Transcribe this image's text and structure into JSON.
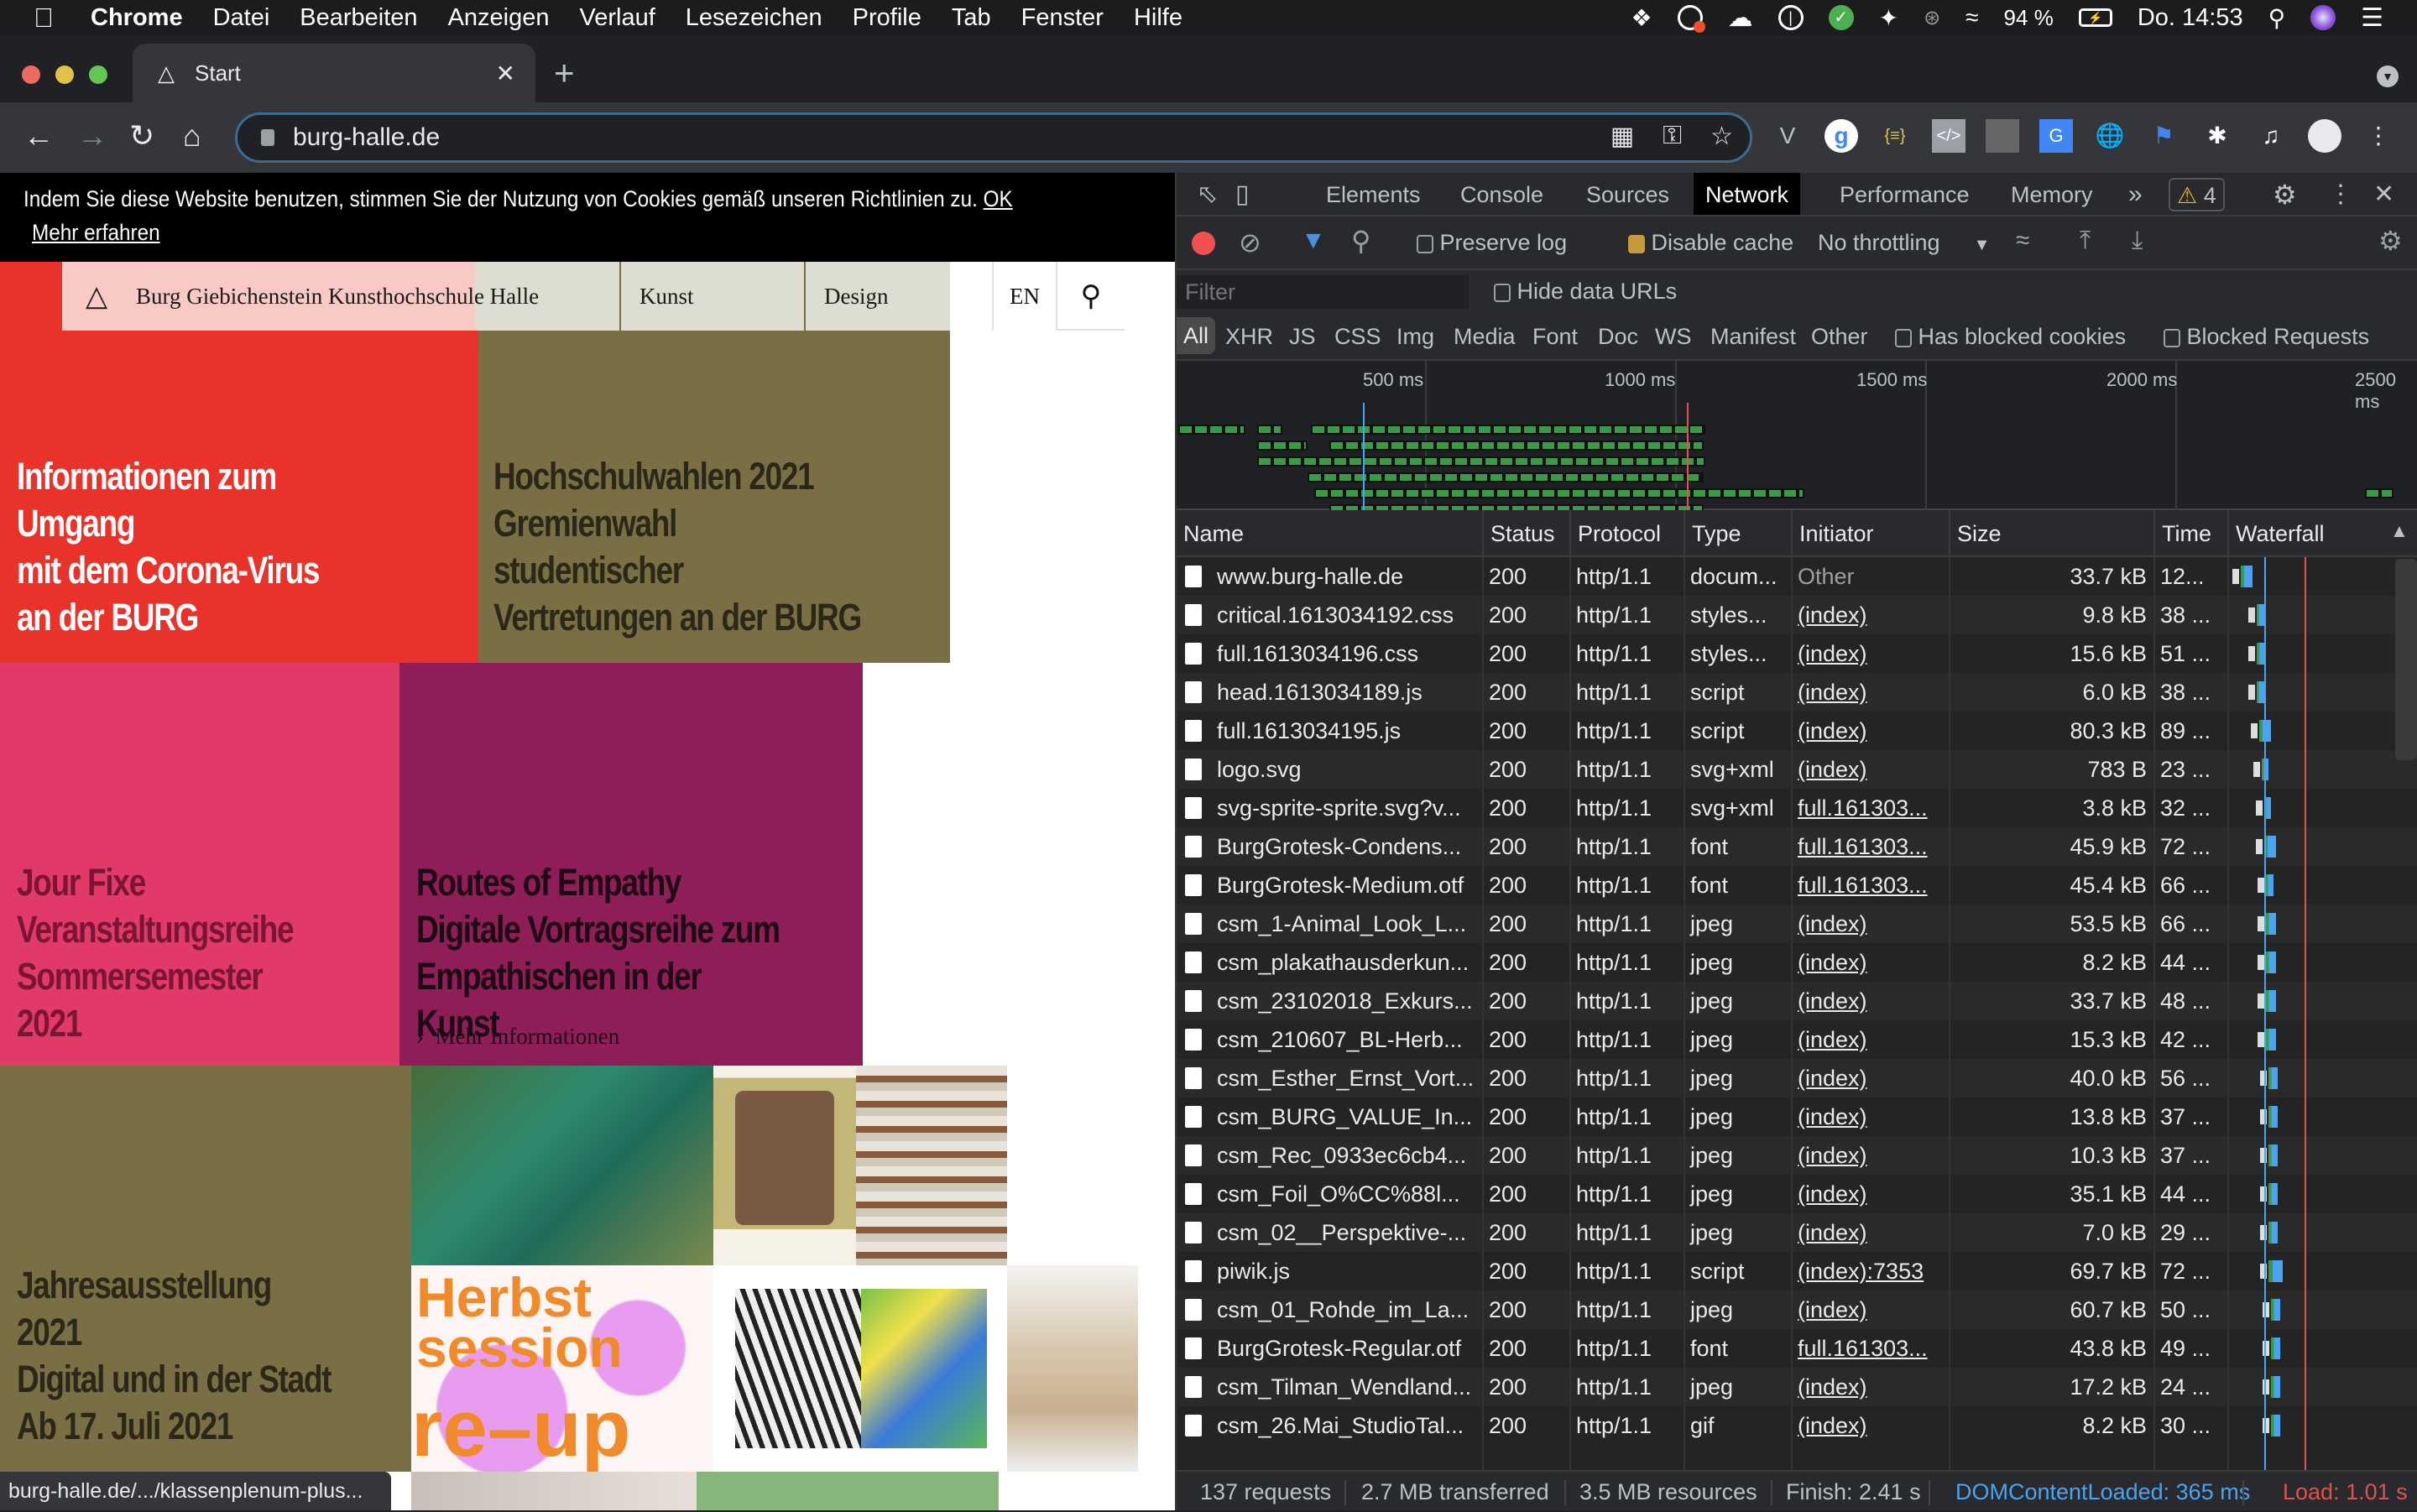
{
  "menubar": {
    "app": "Chrome",
    "items": [
      "Datei",
      "Bearbeiten",
      "Anzeigen",
      "Verlauf",
      "Lesezeichen",
      "Profile",
      "Tab",
      "Fenster",
      "Hilfe"
    ],
    "battery": "94 %",
    "clock": "Do. 14:53",
    "status_icons": [
      "dropbox-icon",
      "creative-cloud-icon",
      "cloud-pause-icon",
      "1password-icon",
      "checkmark-icon",
      "fluid-icon",
      "bluetooth-icon",
      "wifi-icon",
      "battery-icon",
      "spotlight-icon",
      "siri-icon",
      "control-center-icon"
    ]
  },
  "browser": {
    "tab_title": "Start",
    "url": "burg-halle.de",
    "status_url": "burg-halle.de/.../klassenplenum-plus..."
  },
  "website": {
    "cookie_text": "Indem Sie diese Website benutzen, stimmen Sie der Nutzung von Cookies gemäß unseren Richtlinien zu.",
    "cookie_ok": "OK",
    "cookie_more": "Mehr erfahren",
    "brand": "Burg Giebichenstein Kunsthochschule Halle",
    "nav": [
      "Kunst",
      "Design"
    ],
    "lang": "EN",
    "tiles": [
      {
        "lines": [
          "Informationen zum Umgang",
          "mit dem Corona-Virus",
          "an der BURG"
        ],
        "bg": "#e8322a",
        "fg": "#ffffff"
      },
      {
        "lines": [
          "Hochschulwahlen 2021",
          "Gremienwahl studentischer",
          "Vertretungen an der BURG"
        ],
        "bg": "#7a6e45",
        "fg": "#2b2818"
      },
      {
        "lines": [
          "Jour Fixe",
          "Veranstaltungsreihe",
          "Sommersemester 2021"
        ],
        "bg": "#e23a68",
        "fg": "#7a1535"
      },
      {
        "lines": [
          "Routes of Empathy",
          "Digitale Vortragsreihe zum",
          "Empathischen in der Kunst"
        ],
        "bg": "#8f1d58",
        "fg": "#1e0a14",
        "more": "Mehr Informationen"
      },
      {
        "lines": [
          "Jahresausstellung 2021",
          "Digital und in der Stadt",
          "Ab 17. Juli 2021"
        ],
        "bg": "#7a6e45",
        "fg": "#2b2818"
      }
    ]
  },
  "devtools": {
    "tabs": [
      "Elements",
      "Console",
      "Sources",
      "Network",
      "Performance",
      "Memory"
    ],
    "active_tab": "Network",
    "warnings": "4",
    "toolbar": {
      "preserve_log": "Preserve log",
      "preserve_log_checked": false,
      "disable_cache": "Disable cache",
      "disable_cache_checked": true,
      "throttling": "No throttling"
    },
    "filter_placeholder": "Filter",
    "hide_data_urls": "Hide data URLs",
    "type_filters": [
      "All",
      "XHR",
      "JS",
      "CSS",
      "Img",
      "Media",
      "Font",
      "Doc",
      "WS",
      "Manifest",
      "Other"
    ],
    "has_blocked_cookies": "Has blocked cookies",
    "blocked_requests": "Blocked Requests",
    "overview_ticks": [
      "500 ms",
      "1000 ms",
      "1500 ms",
      "2000 ms",
      "2500 ms"
    ],
    "columns": [
      "Name",
      "Status",
      "Protocol",
      "Type",
      "Initiator",
      "Size",
      "Time",
      "Waterfall"
    ],
    "requests": [
      {
        "name": "www.burg-halle.de",
        "status": "200",
        "protocol": "http/1.1",
        "type": "docum...",
        "initiator": "Other",
        "size": "33.7 kB",
        "time": "12...",
        "start": 0.02,
        "dur": 0.05
      },
      {
        "name": "critical.1613034192.css",
        "status": "200",
        "protocol": "http/1.1",
        "type": "styles...",
        "initiator": "(index)",
        "size": "9.8 kB",
        "time": "38 ...",
        "start": 0.09,
        "dur": 0.03
      },
      {
        "name": "full.1613034196.css",
        "status": "200",
        "protocol": "http/1.1",
        "type": "styles...",
        "initiator": "(index)",
        "size": "15.6 kB",
        "time": "51 ...",
        "start": 0.09,
        "dur": 0.04
      },
      {
        "name": "head.1613034189.js",
        "status": "200",
        "protocol": "http/1.1",
        "type": "script",
        "initiator": "(index)",
        "size": "6.0 kB",
        "time": "38 ...",
        "start": 0.09,
        "dur": 0.03
      },
      {
        "name": "full.1613034195.js",
        "status": "200",
        "protocol": "http/1.1",
        "type": "script",
        "initiator": "(index)",
        "size": "80.3 kB",
        "time": "89 ...",
        "start": 0.1,
        "dur": 0.05
      },
      {
        "name": "logo.svg",
        "status": "200",
        "protocol": "http/1.1",
        "type": "svg+xml",
        "initiator": "(index)",
        "size": "783 B",
        "time": "23 ...",
        "start": 0.11,
        "dur": 0.03
      },
      {
        "name": "svg-sprite-sprite.svg?v...",
        "status": "200",
        "protocol": "http/1.1",
        "type": "svg+xml",
        "initiator": "full.161303...",
        "size": "3.8 kB",
        "time": "32 ...",
        "start": 0.12,
        "dur": 0.03
      },
      {
        "name": "BurgGrotesk-Condens...",
        "status": "200",
        "protocol": "http/1.1",
        "type": "font",
        "initiator": "full.161303...",
        "size": "45.9 kB",
        "time": "72 ...",
        "start": 0.12,
        "dur": 0.05
      },
      {
        "name": "BurgGrotesk-Medium.otf",
        "status": "200",
        "protocol": "http/1.1",
        "type": "font",
        "initiator": "full.161303...",
        "size": "45.4 kB",
        "time": "66 ...",
        "start": 0.13,
        "dur": 0.03
      },
      {
        "name": "csm_1-Animal_Look_L...",
        "status": "200",
        "protocol": "http/1.1",
        "type": "jpeg",
        "initiator": "(index)",
        "size": "53.5 kB",
        "time": "66 ...",
        "start": 0.13,
        "dur": 0.04
      },
      {
        "name": "csm_plakathausderkun...",
        "status": "200",
        "protocol": "http/1.1",
        "type": "jpeg",
        "initiator": "(index)",
        "size": "8.2 kB",
        "time": "44 ...",
        "start": 0.13,
        "dur": 0.04
      },
      {
        "name": "csm_23102018_Exkurs...",
        "status": "200",
        "protocol": "http/1.1",
        "type": "jpeg",
        "initiator": "(index)",
        "size": "33.7 kB",
        "time": "48 ...",
        "start": 0.13,
        "dur": 0.04
      },
      {
        "name": "csm_210607_BL-Herb...",
        "status": "200",
        "protocol": "http/1.1",
        "type": "jpeg",
        "initiator": "(index)",
        "size": "15.3 kB",
        "time": "42 ...",
        "start": 0.13,
        "dur": 0.04
      },
      {
        "name": "csm_Esther_Ernst_Vort...",
        "status": "200",
        "protocol": "http/1.1",
        "type": "jpeg",
        "initiator": "(index)",
        "size": "40.0 kB",
        "time": "56 ...",
        "start": 0.14,
        "dur": 0.04
      },
      {
        "name": "csm_BURG_VALUE_In...",
        "status": "200",
        "protocol": "http/1.1",
        "type": "jpeg",
        "initiator": "(index)",
        "size": "13.8 kB",
        "time": "37 ...",
        "start": 0.14,
        "dur": 0.04
      },
      {
        "name": "csm_Rec_0933ec6cb4...",
        "status": "200",
        "protocol": "http/1.1",
        "type": "jpeg",
        "initiator": "(index)",
        "size": "10.3 kB",
        "time": "37 ...",
        "start": 0.14,
        "dur": 0.04
      },
      {
        "name": "csm_Foil_O%CC%88l...",
        "status": "200",
        "protocol": "http/1.1",
        "type": "jpeg",
        "initiator": "(index)",
        "size": "35.1 kB",
        "time": "44 ...",
        "start": 0.14,
        "dur": 0.04
      },
      {
        "name": "csm_02__Perspektive-...",
        "status": "200",
        "protocol": "http/1.1",
        "type": "jpeg",
        "initiator": "(index)",
        "size": "7.0 kB",
        "time": "29 ...",
        "start": 0.14,
        "dur": 0.04
      },
      {
        "name": "piwik.js",
        "status": "200",
        "protocol": "http/1.1",
        "type": "script",
        "initiator": "(index):7353",
        "size": "69.7 kB",
        "time": "72 ...",
        "start": 0.14,
        "dur": 0.06
      },
      {
        "name": "csm_01_Rohde_im_La...",
        "status": "200",
        "protocol": "http/1.1",
        "type": "jpeg",
        "initiator": "(index)",
        "size": "60.7 kB",
        "time": "50 ...",
        "start": 0.15,
        "dur": 0.04
      },
      {
        "name": "BurgGrotesk-Regular.otf",
        "status": "200",
        "protocol": "http/1.1",
        "type": "font",
        "initiator": "full.161303...",
        "size": "43.8 kB",
        "time": "49 ...",
        "start": 0.15,
        "dur": 0.04
      },
      {
        "name": "csm_Tilman_Wendland...",
        "status": "200",
        "protocol": "http/1.1",
        "type": "jpeg",
        "initiator": "(index)",
        "size": "17.2 kB",
        "time": "24 ...",
        "start": 0.15,
        "dur": 0.04
      },
      {
        "name": "csm_26.Mai_StudioTal...",
        "status": "200",
        "protocol": "http/1.1",
        "type": "gif",
        "initiator": "(index)",
        "size": "8.2 kB",
        "time": "30 ...",
        "start": 0.15,
        "dur": 0.04
      }
    ],
    "summary": {
      "requests": "137 requests",
      "transferred": "2.7 MB transferred",
      "resources": "3.5 MB resources",
      "finish": "Finish: 2.41 s",
      "dom_content_loaded": "DOMContentLoaded: 365 ms",
      "load": "Load: 1.01 s"
    },
    "colors": {
      "dcl": "#4aa3f0",
      "load": "#e0534a",
      "active_tab_bg": "#000000",
      "checkbox_checked": "#c69a3b",
      "record": "#f05050"
    }
  }
}
